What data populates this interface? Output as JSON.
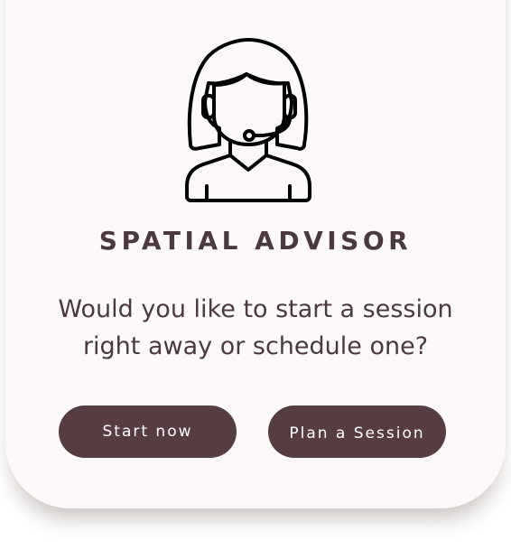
{
  "advisor": {
    "avatar_icon": "headset-support-agent-icon",
    "title": "SPATIAL ADVISOR",
    "question_line1": "Would you like to start a session",
    "question_line2": "right away or schedule one?"
  },
  "actions": {
    "start_label": "Start now",
    "plan_label": "Plan a Session"
  },
  "colors": {
    "card_background": "#fdf9fa",
    "text": "#4a393e",
    "button": "#553d42",
    "button_text": "#ffffff"
  }
}
